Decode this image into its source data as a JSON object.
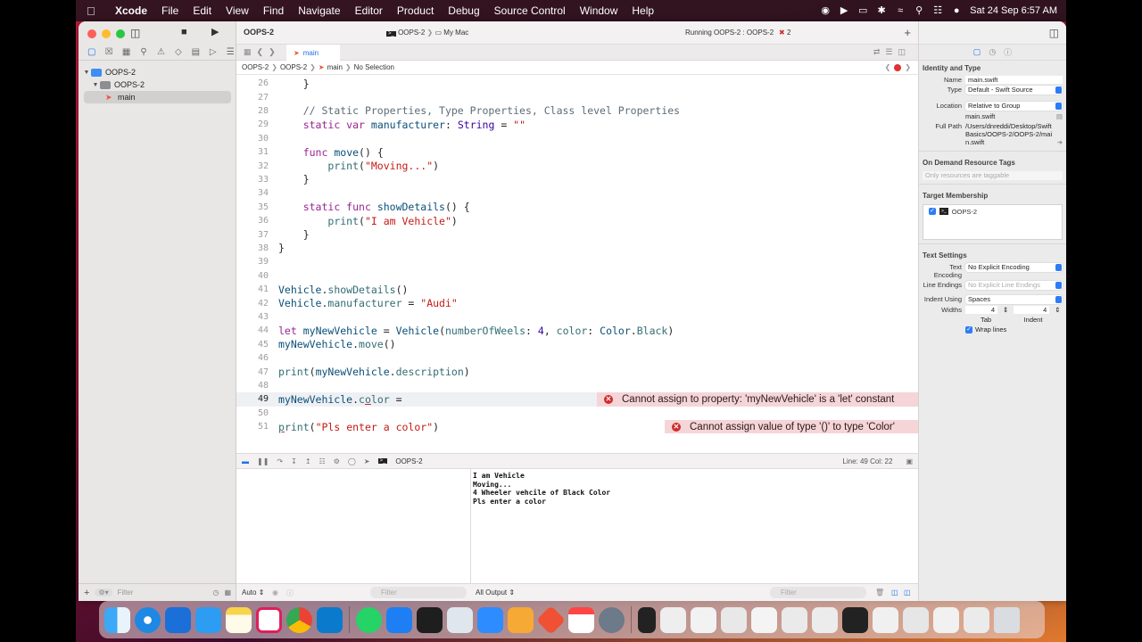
{
  "menubar": {
    "app": "Xcode",
    "items": [
      "File",
      "Edit",
      "View",
      "Find",
      "Navigate",
      "Editor",
      "Product",
      "Debug",
      "Source Control",
      "Window",
      "Help"
    ],
    "clock": "Sat 24 Sep  6:57 AM"
  },
  "navigator": {
    "project": "OOPS-2",
    "group": "OOPS-2",
    "file": "main",
    "filter_placeholder": "Filter"
  },
  "toolbar": {
    "project_title": "OOPS-2",
    "scheme": "OOPS-2",
    "destination": "My Mac",
    "status": "Running OOPS-2 : OOPS-2",
    "error_count": "2"
  },
  "tab": {
    "label": "main"
  },
  "jumpbar": {
    "items": [
      "OOPS-2",
      "OOPS-2",
      "main",
      "No Selection"
    ]
  },
  "code": {
    "current_line": "49",
    "lines": [
      {
        "n": "26"
      },
      {
        "n": "27"
      },
      {
        "n": "28"
      },
      {
        "n": "29"
      },
      {
        "n": "30"
      },
      {
        "n": "31"
      },
      {
        "n": "32"
      },
      {
        "n": "33"
      },
      {
        "n": "34"
      },
      {
        "n": "35"
      },
      {
        "n": "36"
      },
      {
        "n": "37"
      },
      {
        "n": "38"
      },
      {
        "n": "39"
      },
      {
        "n": "40"
      },
      {
        "n": "41"
      },
      {
        "n": "42"
      },
      {
        "n": "43"
      },
      {
        "n": "44"
      },
      {
        "n": "45"
      },
      {
        "n": "46"
      },
      {
        "n": "47"
      },
      {
        "n": "48"
      },
      {
        "n": "49"
      },
      {
        "n": "50"
      },
      {
        "n": "51"
      }
    ],
    "errors": [
      {
        "line": "49",
        "message": "Cannot assign to property: 'myNewVehicle' is a 'let' constant"
      },
      {
        "line": "51",
        "message": "Cannot assign value of type '()' to type 'Color'"
      }
    ]
  },
  "debug": {
    "target": "OOPS-2",
    "position": "Line: 49  Col: 22",
    "console_lines": [
      "I am Vehicle",
      "Moving...",
      "4 Wheeler vehcile of Black Color",
      "Pls enter a color"
    ],
    "auto_label": "Auto",
    "output_label": "All Output",
    "filter_placeholder": "Filter"
  },
  "inspector": {
    "identity_title": "Identity and Type",
    "name_label": "Name",
    "name_value": "main.swift",
    "type_label": "Type",
    "type_value": "Default - Swift Source",
    "location_label": "Location",
    "location_value": "Relative to Group",
    "location_file": "main.swift",
    "fullpath_label": "Full Path",
    "fullpath_value": "/Users/dnreddi/Desktop/Swift Basics/OOPS-2/OOPS-2/main.swift",
    "odr_title": "On Demand Resource Tags",
    "odr_placeholder": "Only resources are taggable",
    "target_title": "Target Membership",
    "target_item": "OOPS-2",
    "text_title": "Text Settings",
    "encoding_label": "Text Encoding",
    "encoding_value": "No Explicit Encoding",
    "endings_label": "Line Endings",
    "endings_value": "No Explicit Line Endings",
    "indent_label": "Indent Using",
    "indent_value": "Spaces",
    "widths_label": "Widths",
    "tab_width": "4",
    "indent_width": "4",
    "tab_label": "Tab",
    "indent_label2": "Indent",
    "wrap_label": "Wrap lines"
  },
  "colors": {
    "accent": "#1c6fe8",
    "error": "#cf2b2b",
    "error_bg": "#f5d5d8"
  }
}
